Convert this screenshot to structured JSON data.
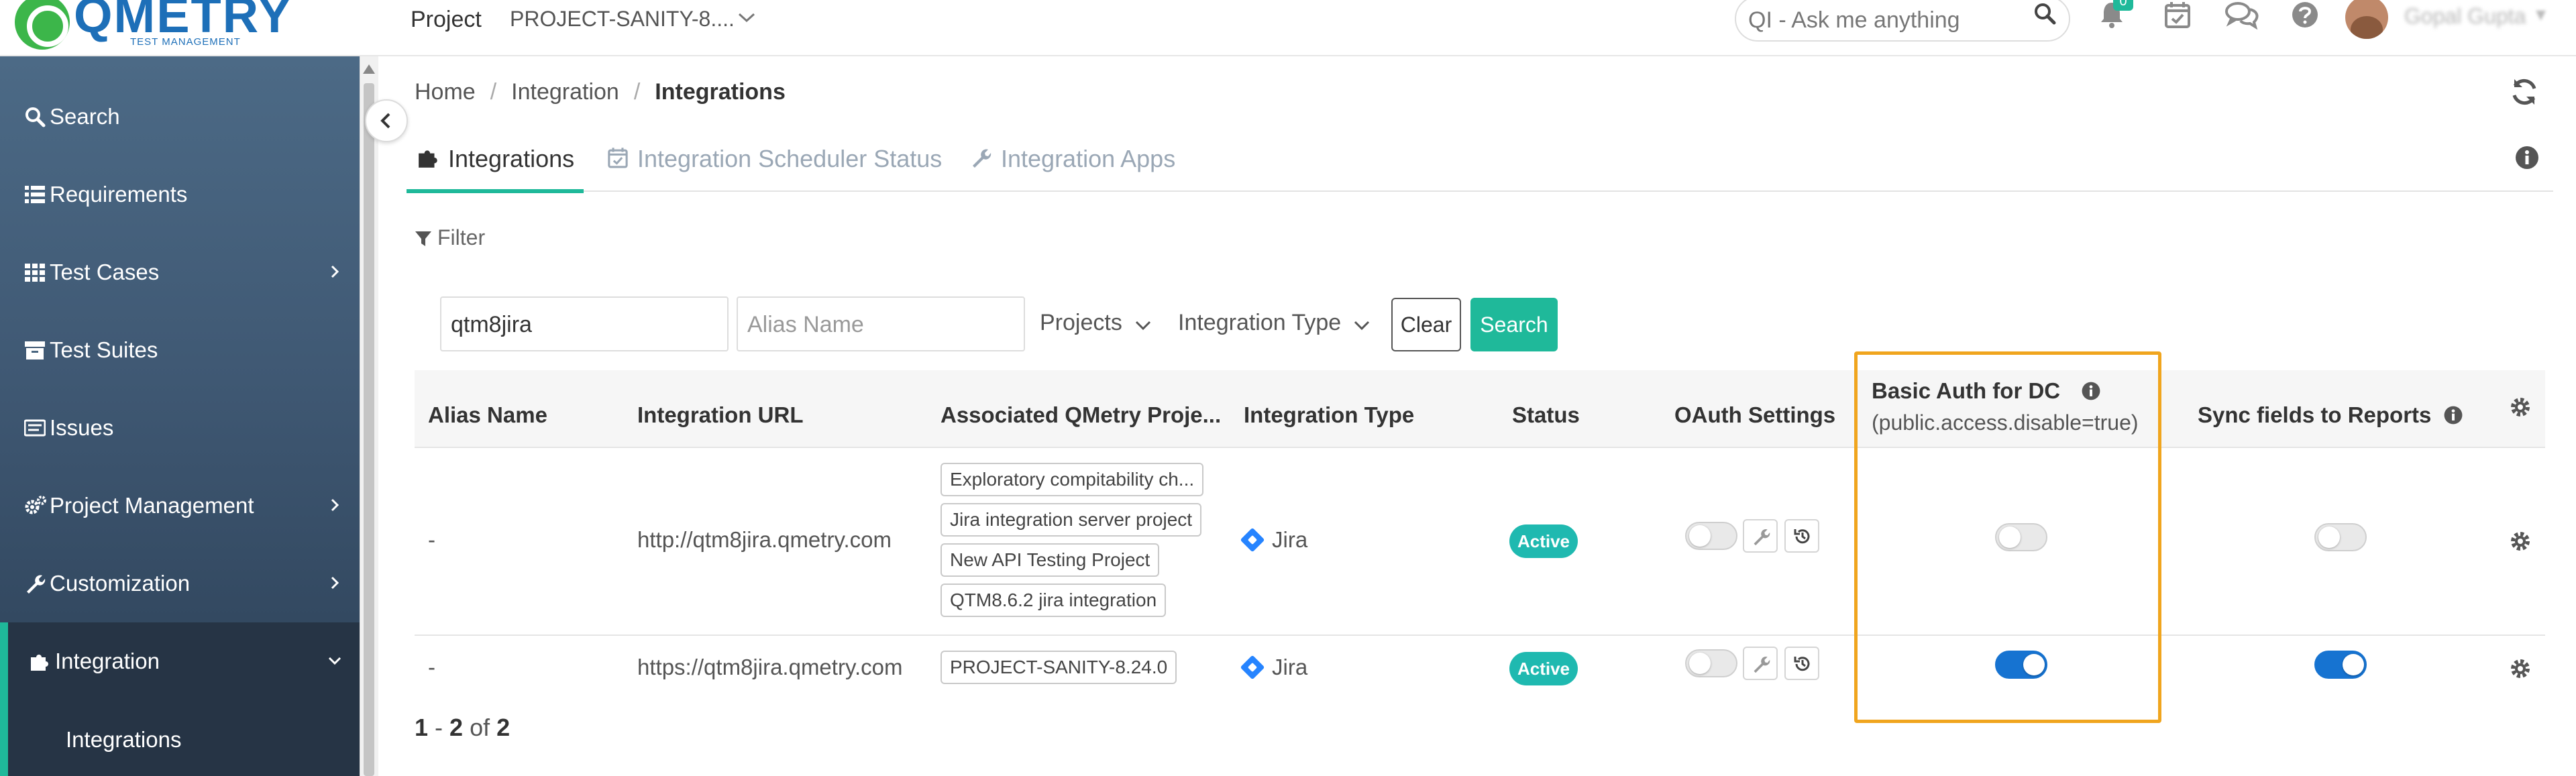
{
  "header": {
    "logo_text": "QMETRY",
    "logo_subtext": "TEST MANAGEMENT",
    "project_label": "Project",
    "project_name": "PROJECT-SANITY-8....",
    "ai_search_placeholder": "QI - Ask me anything",
    "notification_count": "0",
    "user_name": "Gopal Gupta"
  },
  "sidebar": {
    "items": [
      {
        "label": "Search",
        "icon": "search-icon"
      },
      {
        "label": "Requirements",
        "icon": "list-icon"
      },
      {
        "label": "Test Cases",
        "icon": "grid-icon"
      },
      {
        "label": "Test Suites",
        "icon": "archive-icon"
      },
      {
        "label": "Issues",
        "icon": "issues-icon"
      },
      {
        "label": "Project Management",
        "icon": "cogs-icon"
      },
      {
        "label": "Customization",
        "icon": "wrench-icon"
      },
      {
        "label": "Integration",
        "icon": "puzzle-icon"
      }
    ],
    "sub_item": "Integrations"
  },
  "breadcrumb": {
    "items": [
      "Home",
      "Integration",
      "Integrations"
    ]
  },
  "tabs": [
    {
      "label": "Integrations",
      "icon": "puzzle-icon",
      "active": true
    },
    {
      "label": "Integration Scheduler Status",
      "icon": "calendar-check-icon",
      "active": false
    },
    {
      "label": "Integration Apps",
      "icon": "wrench-icon",
      "active": false
    }
  ],
  "filter": {
    "label": "Filter",
    "url_value": "qtm8jira",
    "alias_placeholder": "Alias Name",
    "projects_label": "Projects",
    "integration_type_label": "Integration Type",
    "clear_label": "Clear",
    "search_label": "Search"
  },
  "table": {
    "columns": [
      "Alias Name",
      "Integration URL",
      "Associated QMetry Proje...",
      "Integration Type",
      "Status",
      "OAuth Settings",
      "Basic Auth for DC",
      "Sync fields to Reports"
    ],
    "basic_auth_sub": "(public.access.disable=true)",
    "rows": [
      {
        "alias": "-",
        "url": "http://qtm8jira.qmetry.com",
        "projects": [
          "Exploratory compitability ch...",
          "Jira integration server project",
          "New API Testing Project",
          "QTM8.6.2 jira integration"
        ],
        "type": "Jira",
        "status": "Active",
        "oauth_enabled": false,
        "basic_auth_enabled": false,
        "sync_enabled": false
      },
      {
        "alias": "-",
        "url": "https://qtm8jira.qmetry.com",
        "projects": [
          "PROJECT-SANITY-8.24.0"
        ],
        "type": "Jira",
        "status": "Active",
        "oauth_enabled": false,
        "basic_auth_enabled": true,
        "sync_enabled": true
      }
    ]
  },
  "pagination": {
    "start": "1",
    "end": "2",
    "of_label": "of",
    "total": "2"
  },
  "colors": {
    "accent": "#1fb99a",
    "toggle_on": "#1673d1",
    "highlight": "#f0a51e",
    "sidebar_top": "#4c6a86",
    "sidebar_bottom": "#2b3f55"
  }
}
